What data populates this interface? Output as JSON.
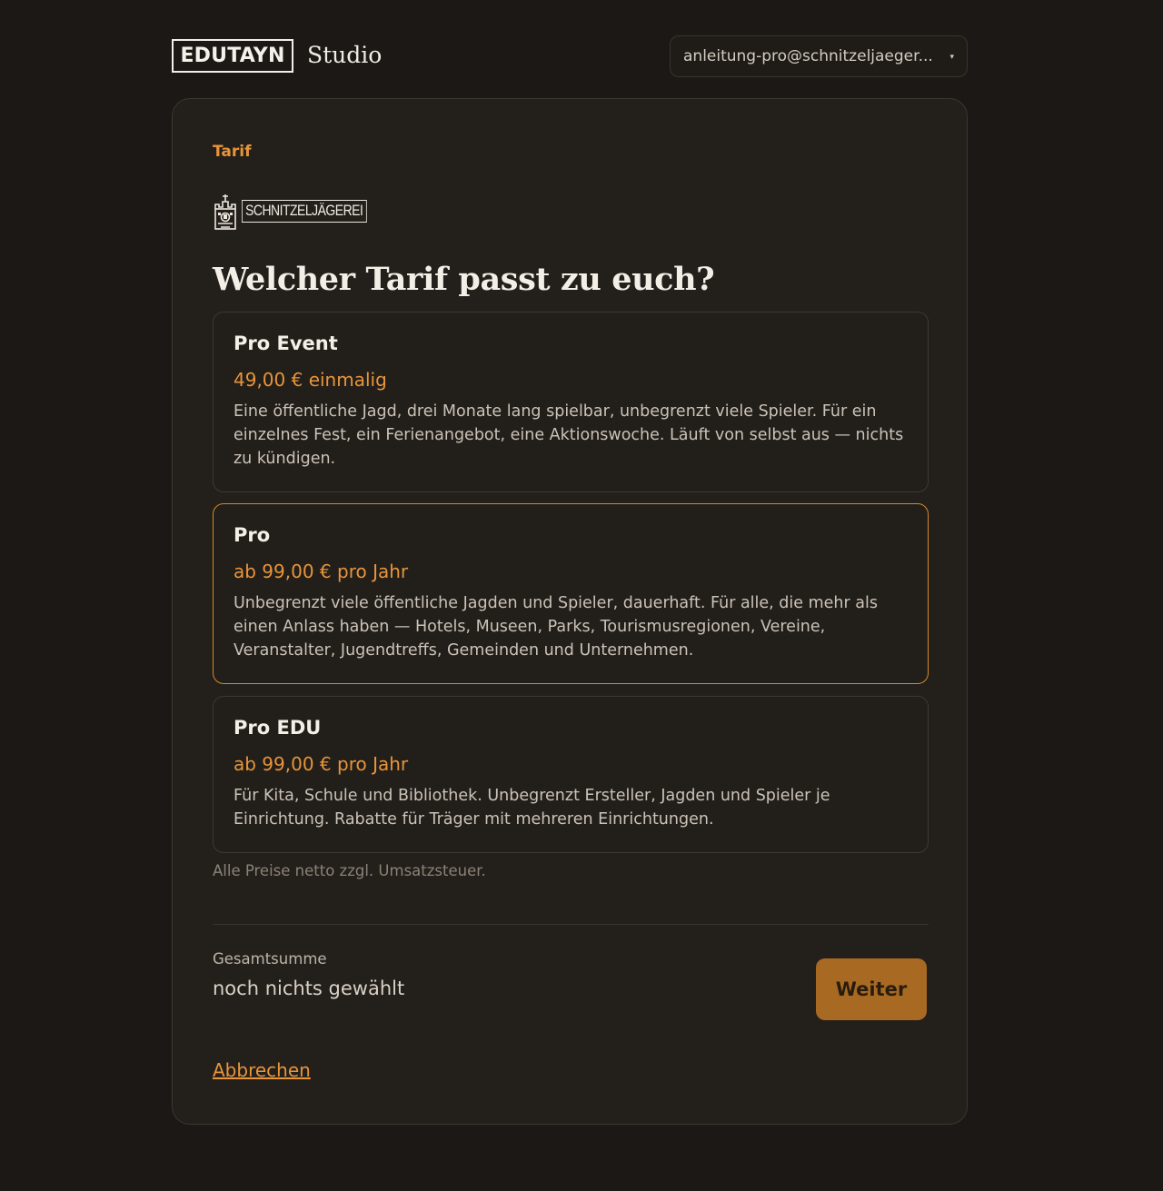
{
  "header": {
    "brand": "EDUTAYN",
    "product": "Studio",
    "account_email": "anleitung-pro@schnitzeljaeger...",
    "account_caret": "▾"
  },
  "card": {
    "eyebrow": "Tarif",
    "org_logo_text": "SCHNITZELJÄGEREI",
    "question": "Welcher Tarif passt zu euch?",
    "plans": [
      {
        "name": "Pro Event",
        "price": "49,00 € einmalig",
        "description": "Eine öffentliche Jagd, drei Monate lang spielbar, unbegrenzt viele Spieler. Für ein einzelnes Fest, ein Ferienangebot, eine Aktionswoche. Läuft von selbst aus — nichts zu kündigen."
      },
      {
        "name": "Pro",
        "price": "ab 99,00 € pro Jahr",
        "description": "Unbegrenzt viele öffentliche Jagden und Spieler, dauerhaft. Für alle, die mehr als einen Anlass haben — Hotels, Museen, Parks, Tourismusregionen, Vereine, Veranstalter, Jugendtreffs, Gemeinden und Unternehmen."
      },
      {
        "name": "Pro EDU",
        "price": "ab 99,00 € pro Jahr",
        "description": "Für Kita, Schule und Bibliothek. Unbegrenzt Ersteller, Jagden und Spieler je Einrichtung. Rabatte für Träger mit mehreren Einrichtungen."
      }
    ],
    "net_note": "Alle Preise netto zzgl. Umsatzsteuer.",
    "total_label": "Gesamtsumme",
    "total_value": "noch nichts gewählt",
    "next_label": "Weiter",
    "cancel_label": "Abbrechen"
  },
  "colors": {
    "accent": "#e8953a",
    "button": "#a86a23",
    "background": "#1c1815",
    "card": "#231f1b"
  }
}
